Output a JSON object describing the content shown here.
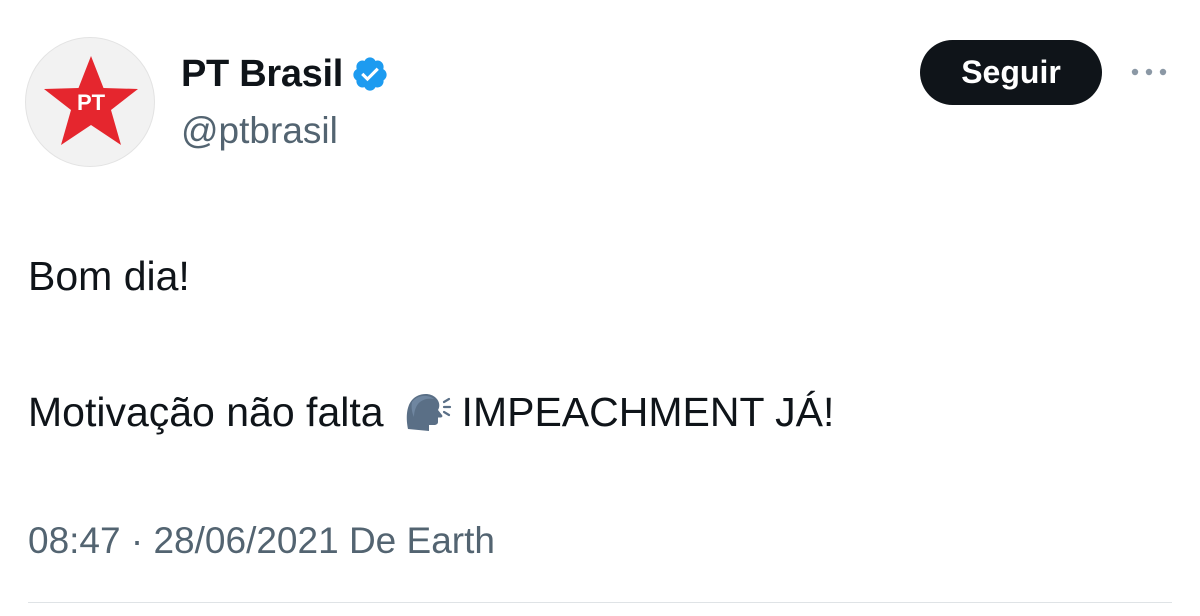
{
  "author": {
    "display_name": "PT Brasil",
    "handle": "@ptbrasil",
    "avatar_icon": "pt-red-star-logo",
    "avatar_text": "PT",
    "verified_icon": "verified-badge-icon"
  },
  "actions": {
    "follow_label": "Seguir",
    "more_icon": "more-options-icon"
  },
  "tweet": {
    "line1": "Bom dia!",
    "line2_before": "Motivação não falta",
    "line2_emoji": "speaking-head-icon",
    "line2_after": "IMPEACHMENT JÁ!"
  },
  "meta": {
    "time": "08:47",
    "separator": "·",
    "date": "28/06/2021",
    "source": "De Earth"
  },
  "colors": {
    "text": "#0f1419",
    "secondary_text": "#536471",
    "verified_blue": "#1d9bf0",
    "star_red": "#e5262e",
    "button_bg": "#0f1419"
  }
}
